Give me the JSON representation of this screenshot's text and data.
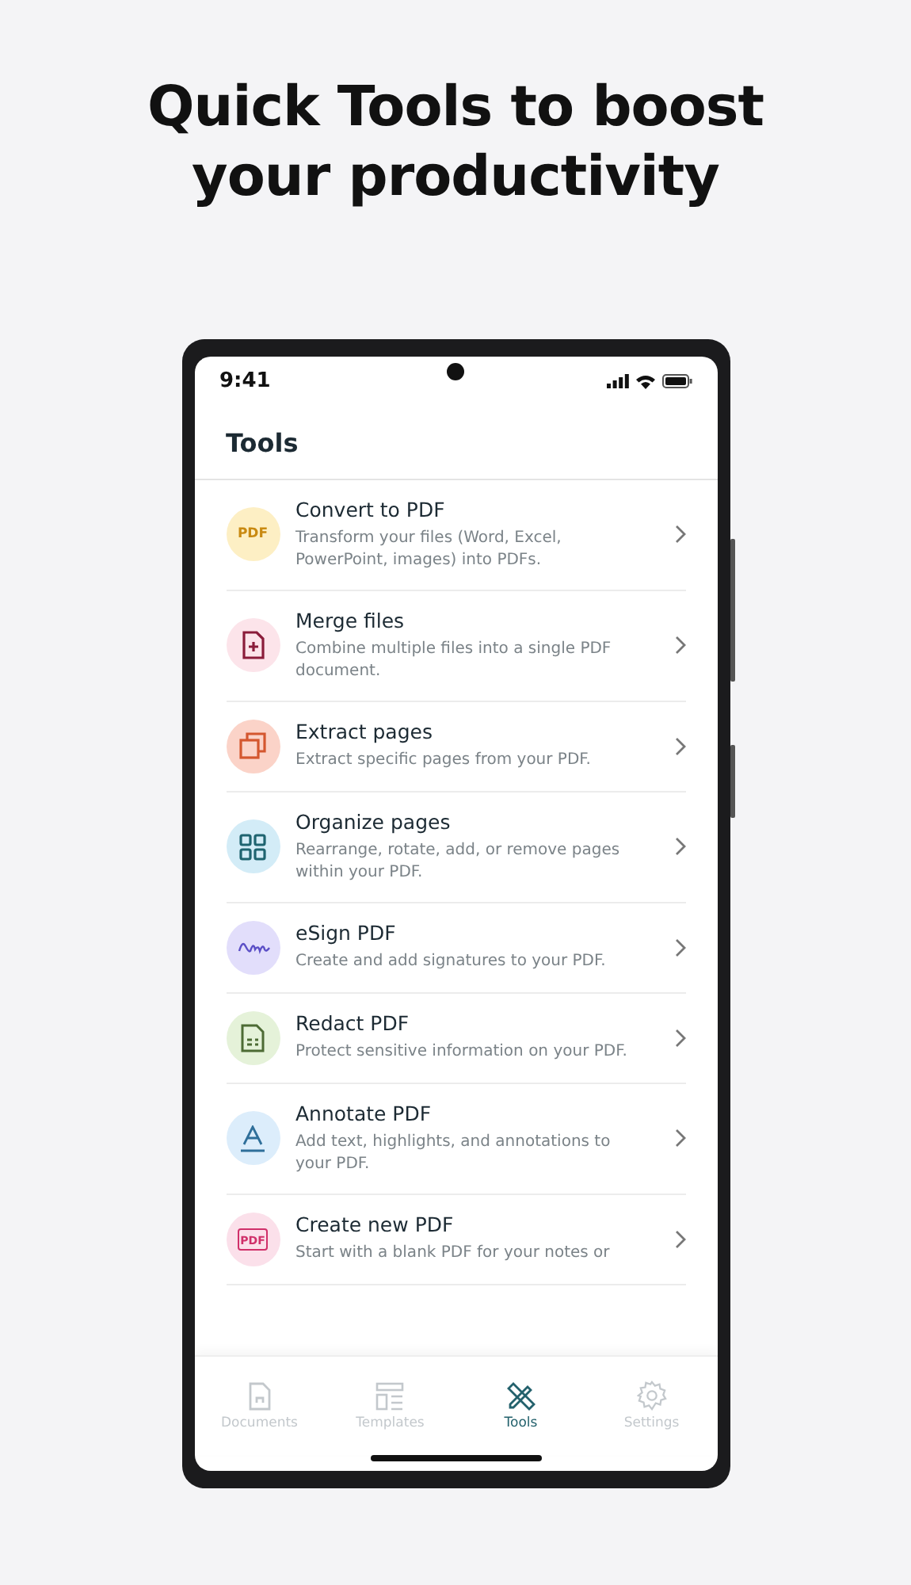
{
  "headline": [
    "Quick Tools to boost",
    "your productivity"
  ],
  "status_bar": {
    "time": "9:41"
  },
  "header": {
    "title": "Tools"
  },
  "tools": [
    {
      "kind": "pdf-badge",
      "icon_text": "PDF",
      "color": "#fdefc4",
      "title": "Convert to PDF",
      "description": "Transform your files (Word, Excel, PowerPoint, images) into PDFs."
    },
    {
      "kind": "file-plus",
      "color": "#fce4ea",
      "title": "Merge files",
      "description": "Combine multiple files into a single PDF document."
    },
    {
      "kind": "copy",
      "color": "#fbd3c8",
      "title": "Extract pages",
      "description": "Extract specific pages from your PDF."
    },
    {
      "kind": "grid",
      "color": "#d3ecf7",
      "title": "Organize pages",
      "description": "Rearrange, rotate, add, or remove pages within your PDF."
    },
    {
      "kind": "signature",
      "color": "#e2defb",
      "title": "eSign PDF",
      "description": "Create and add signatures to your PDF."
    },
    {
      "kind": "redact",
      "color": "#e5f2d9",
      "title": "Redact PDF",
      "description": "Protect sensitive information on your PDF."
    },
    {
      "kind": "text-a",
      "color": "#dcedfb",
      "title": "Annotate PDF",
      "description": "Add text, highlights, and annotations to your PDF."
    },
    {
      "kind": "pdf-file",
      "icon_text": "PDF",
      "color": "#fbe0ea",
      "title": "Create new PDF",
      "description": "Start with a blank PDF for your notes or"
    }
  ],
  "nav": [
    {
      "kind": "document",
      "label": "Documents",
      "selected": false
    },
    {
      "kind": "template",
      "label": "Templates",
      "selected": false
    },
    {
      "kind": "tools",
      "label": "Tools",
      "selected": true
    },
    {
      "kind": "gear",
      "label": "Settings",
      "selected": false
    }
  ]
}
